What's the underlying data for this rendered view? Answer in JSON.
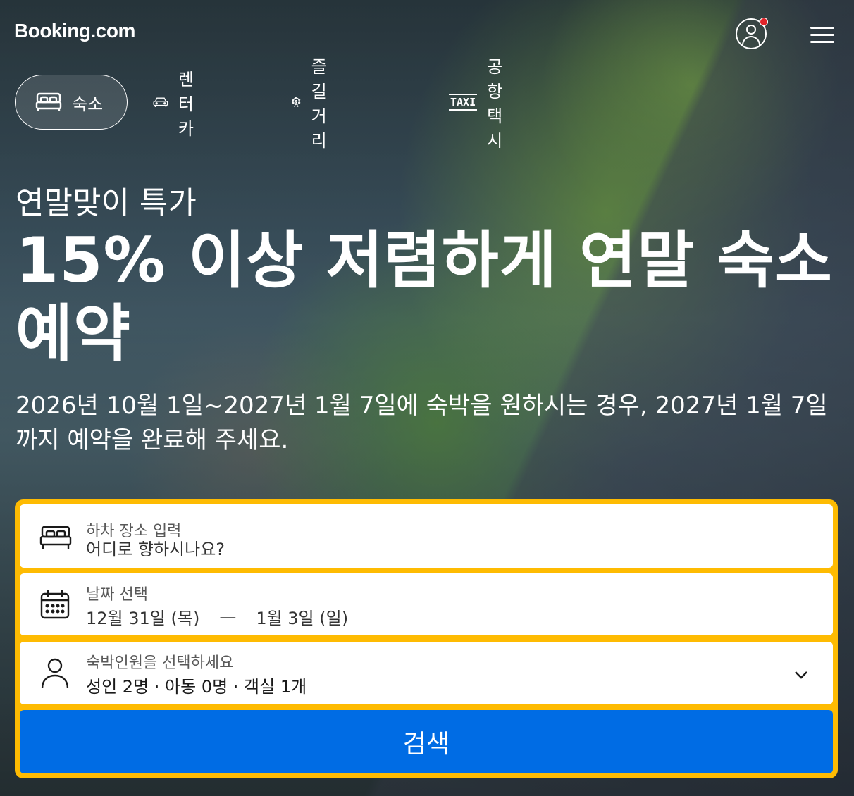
{
  "header": {
    "logo_text": "Booking.com"
  },
  "tabs": [
    {
      "label": "숙소",
      "icon": "bed-icon",
      "active": true
    },
    {
      "label": "렌터카",
      "icon": "car-icon",
      "active": false
    },
    {
      "label": "즐길 거리",
      "icon": "attractions-icon",
      "active": false
    },
    {
      "label": "공항 택시",
      "icon": "taxi-icon",
      "active": false
    }
  ],
  "taxi_icon_text": "TAXI",
  "promo": {
    "subtitle": "연말맞이 특가",
    "headline": "15% 이상 저렴하게 연말 숙소 예약",
    "description": "2026년 10월 1일~2027년 1월 7일에 숙박을 원하시는 경우, 2027년 1월 7일까지 예약을 완료해 주세요."
  },
  "search": {
    "destination": {
      "label": "하차 장소 입력",
      "placeholder": "어디로 향하시나요?"
    },
    "dates": {
      "label": "날짜 선택",
      "checkin": "12월 31일 (목)",
      "separator": "—",
      "checkout": "1월 3일 (일)"
    },
    "guests": {
      "label": "숙박인원을 선택하세요",
      "value": "성인 2명 · 아동 0명 · 객실 1개"
    },
    "button_label": "검색"
  },
  "colors": {
    "search_border": "#febb02",
    "search_button": "#006ce4",
    "notification_dot": "#e0242a"
  }
}
